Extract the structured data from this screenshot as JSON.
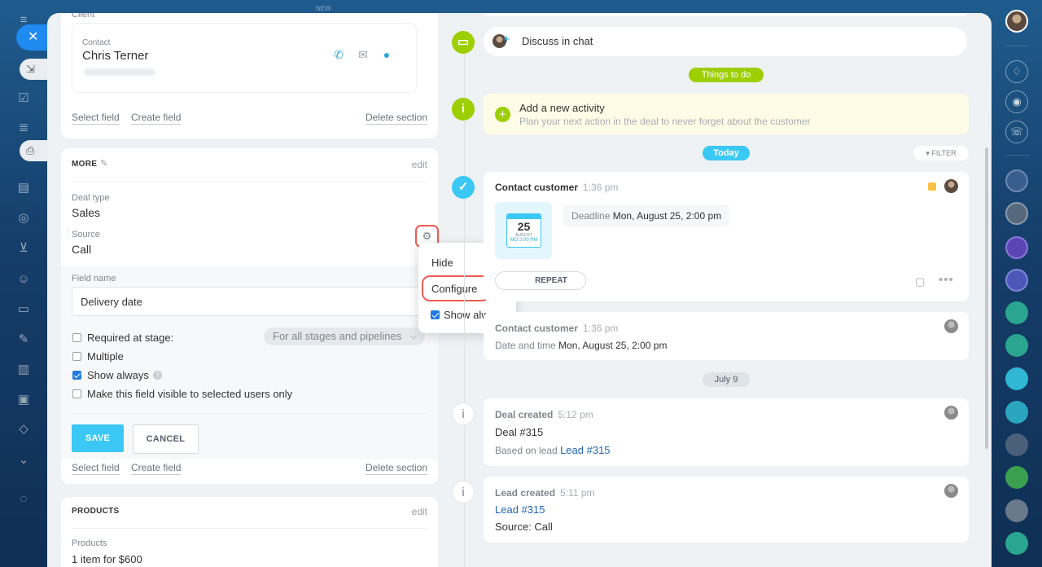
{
  "top_tab": "NEW",
  "client": {
    "section_label": "Client",
    "contact_label": "Contact",
    "contact_name": "Chris Terner",
    "select_field": "Select field",
    "create_field": "Create field",
    "delete_section": "Delete section"
  },
  "more": {
    "title": "MORE",
    "edit": "edit",
    "deal_type_label": "Deal type",
    "deal_type_value": "Sales",
    "source_label": "Source",
    "source_value": "Call",
    "field_name_label": "Field name",
    "field_name_value": "Delivery date",
    "required_label": "Required at stage:",
    "stage_select": "For all stages and pipelines",
    "multiple_label": "Multiple",
    "show_always_label": "Show always",
    "visible_label": "Make this field visible to selected users only",
    "save": "SAVE",
    "cancel": "CANCEL",
    "select_field": "Select field",
    "create_field": "Create field",
    "delete_section": "Delete section"
  },
  "menu": {
    "hide": "Hide",
    "configure": "Configure",
    "show_always": "Show always"
  },
  "products": {
    "title": "PRODUCTS",
    "edit": "edit",
    "label": "Products",
    "value": "1 item for $600"
  },
  "timeline": {
    "discuss": "Discuss in chat",
    "things_to_do": "Things to do",
    "add_activity_title": "Add a new activity",
    "add_activity_sub": "Plan your next action in the deal to never forget about the customer",
    "today": "Today",
    "filter": "FILTER",
    "act1_title": "Contact customer",
    "act1_time": "1:36 pm",
    "cal_day": "25",
    "cal_month": "AUGUST",
    "cal_time": "MO 2:00 PM",
    "deadline_label": "Deadline",
    "deadline_value": "Mon, August 25, 2:00 pm",
    "repeat": "REPEAT",
    "act2_title": "Contact customer",
    "act2_time": "1:36 pm",
    "act2_date_label": "Date and time",
    "act2_date_value": "Mon, August 25, 2:00 pm",
    "july": "July 9",
    "deal_created_title": "Deal created",
    "deal_created_time": "5:12 pm",
    "deal_number": "Deal #315",
    "based_on": "Based on lead",
    "lead_link": "Lead #315",
    "lead_created_title": "Lead created",
    "lead_created_time": "5:11 pm",
    "lead_link2": "Lead #315",
    "source_call": "Source: Call"
  },
  "colors": {
    "accent_blue": "#3bc8f5",
    "green": "#9dcf00",
    "highlight_red": "#ec5c50",
    "link": "#2067b0"
  }
}
